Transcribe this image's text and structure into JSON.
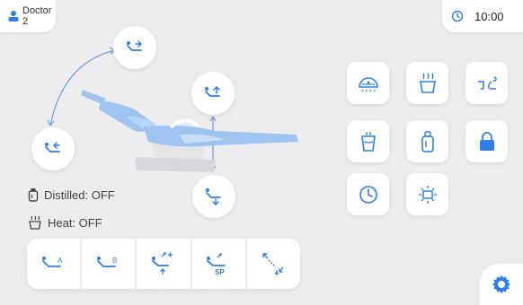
{
  "header": {
    "doctor_label": "Doctor 2",
    "time": "10:00"
  },
  "status": {
    "distilled": "Distilled: OFF",
    "heat": "Heat: OFF"
  },
  "programs": {
    "a_label": "A",
    "b_label": "B",
    "sp_label": "SP"
  },
  "colors": {
    "accent": "#2f7fe8",
    "chair_blue": "#9fc4f0",
    "background": "#ececef"
  },
  "icons": [
    "person-icon",
    "clock-icon",
    "backrest-up-icon",
    "backrest-down-icon",
    "seat-up-icon",
    "seat-down-icon",
    "operating-light-icon",
    "heater-icon",
    "spittoon-icon",
    "cup-fill-icon",
    "water-bottle-icon",
    "lock-icon",
    "timer-icon",
    "light-sensor-icon",
    "gear-icon"
  ]
}
